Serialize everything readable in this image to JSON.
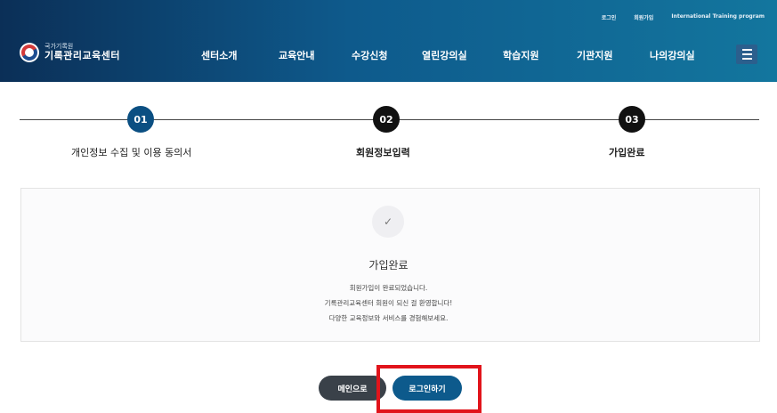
{
  "utility_links": [
    "로그인",
    "회원가입",
    "International Training program"
  ],
  "logo": {
    "top": "국가기록원",
    "bottom": "기록관리교육센터"
  },
  "nav": [
    "센터소개",
    "교육안내",
    "수강신청",
    "열린강의실",
    "학습지원",
    "기관지원",
    "나의강의실"
  ],
  "steps": [
    {
      "number": "01",
      "label": "개인정보 수집 및 이용 동의서",
      "color": "#0b4f82"
    },
    {
      "number": "02",
      "label": "회원정보입력",
      "color": "#111111"
    },
    {
      "number": "03",
      "label": "가입완료",
      "color": "#111111"
    }
  ],
  "result": {
    "check_glyph": "✓",
    "title": "가입완료",
    "messages": [
      "회원가입이 완료되었습니다.",
      "기록관리교육센터 회원이 되신 걸 환영합니다!",
      "다양한 교육정보와 서비스를 경험해보세요."
    ]
  },
  "buttons": {
    "main": {
      "label": "메인으로",
      "color": "#3a4149"
    },
    "login": {
      "label": "로그인하기",
      "color": "#0d5a8c"
    }
  },
  "highlight_color": "#e1141b"
}
